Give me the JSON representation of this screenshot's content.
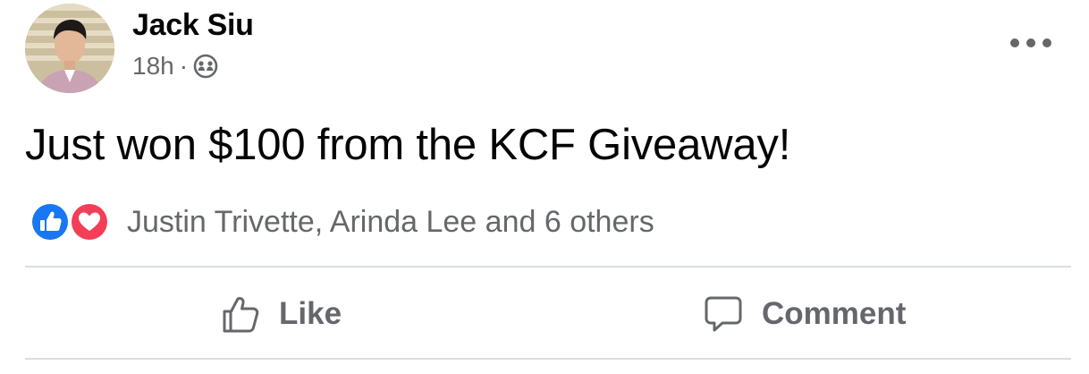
{
  "post": {
    "author": "Jack Siu",
    "time": "18h",
    "separator": "·",
    "audience_icon": "friends-icon",
    "more_icon": "more-options-icon",
    "text": "Just won $100 from the KCF Giveaway!",
    "reactions": {
      "icons": [
        "like-reaction-icon",
        "love-reaction-icon"
      ],
      "summary": "Justin Trivette, Arinda Lee and 6 others"
    },
    "actions": [
      {
        "label": "Like",
        "icon": "thumbs-up-icon"
      },
      {
        "label": "Comment",
        "icon": "comment-icon"
      }
    ]
  },
  "colors": {
    "like_blue": "#1877f2",
    "love_red": "#f33e58",
    "secondary_text": "#65676b",
    "primary_text": "#050505",
    "divider": "#dadde1"
  }
}
